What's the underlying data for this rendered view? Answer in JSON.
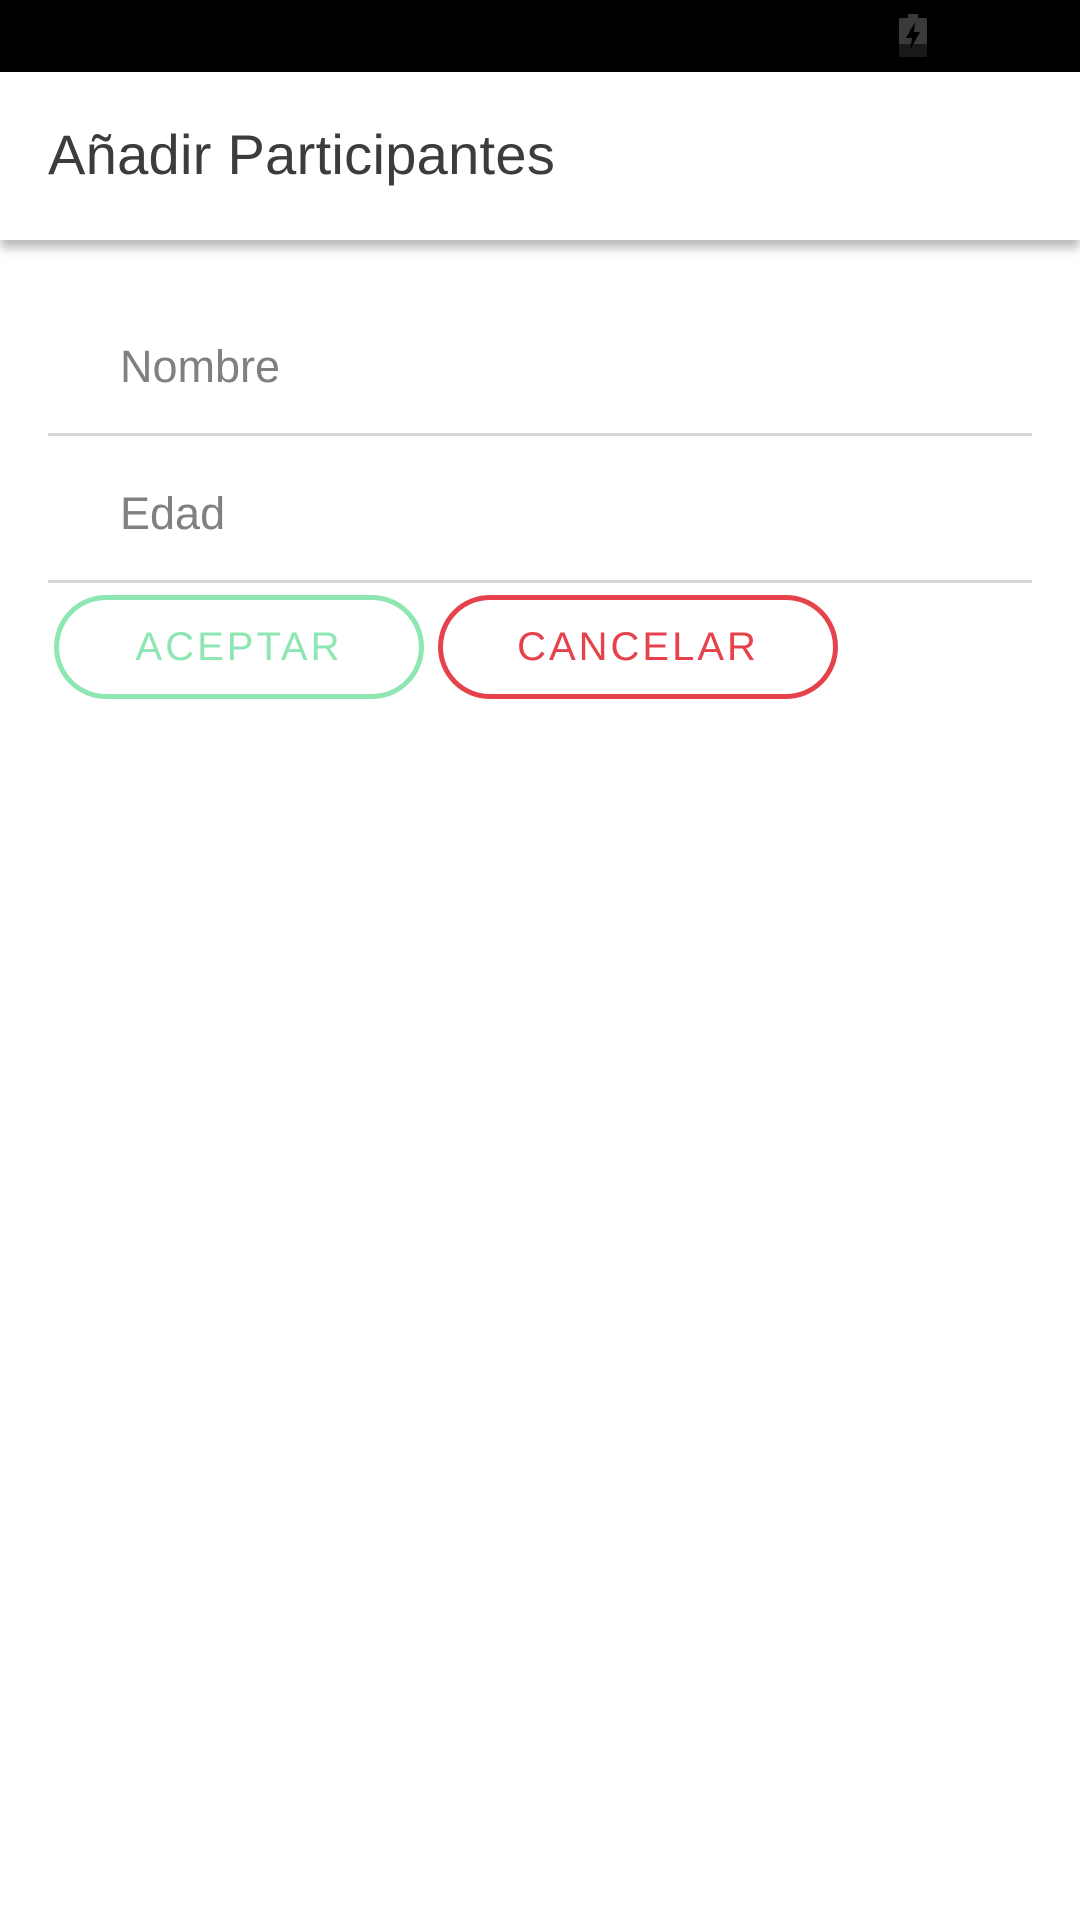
{
  "status_bar": {
    "icons": [
      "battery-charging-icon"
    ]
  },
  "app_bar": {
    "title": "Añadir Participantes"
  },
  "form": {
    "name_field": {
      "placeholder": "Nombre",
      "value": ""
    },
    "age_field": {
      "placeholder": "Edad",
      "value": ""
    },
    "accept_label": "ACEPTAR",
    "cancel_label": "CANCELAR"
  },
  "colors": {
    "status_bar": "#000000",
    "accept": "#8ee6b2",
    "cancel": "#e5424b",
    "title": "#3c3c3c",
    "divider": "#d6d6d6"
  }
}
